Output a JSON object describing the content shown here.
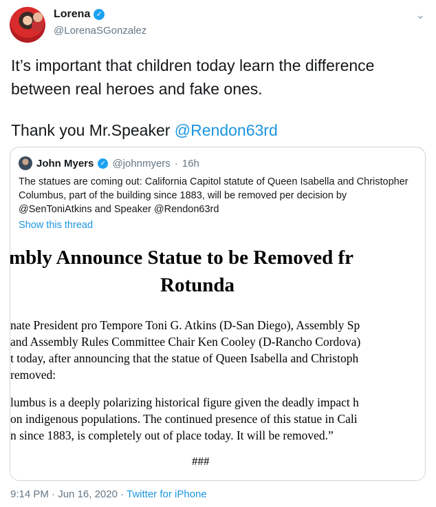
{
  "tweet": {
    "author_name": "Lorena",
    "author_handle": "@LorenaSGonzalez",
    "text_line1": "It’s important that children today learn the difference",
    "text_line2": "between real heroes and fake ones.",
    "text_line3_prefix": "Thank you Mr.Speaker ",
    "text_line3_mention": "@Rendon63rd",
    "timestamp": "9:14 PM · Jun 16, 2020 · ",
    "source": "Twitter for iPhone"
  },
  "quote": {
    "author_name": "John Myers",
    "author_handle": "@johnmyers",
    "separator": "·",
    "age": "16h",
    "text": "The statues are coming out: California Capitol statute of Queen Isabella and Christopher Columbus, part of the building since 1883, will be removed per decision by @SenToniAtkins and Speaker @Rendon63rd",
    "show_thread": "Show this thread",
    "document": {
      "title_line1": "mbly Announce Statue to be Removed fr",
      "title_line2": "Rotunda",
      "lines": [
        "nate President pro Tempore Toni G. Atkins (D-San Diego), Assembly Sp",
        "and Assembly Rules Committee Chair Ken Cooley (D-Rancho Cordova)",
        "t today, after announcing that the statue of Queen Isabella and Christoph",
        " removed:",
        "lumbus is a deeply polarizing historical figure given the deadly impact h",
        "on indigenous populations. The continued presence of this statue in Cali",
        "n since 1883, is completely out of place today. It will be removed.”"
      ],
      "end_mark": "###"
    }
  },
  "icons": {
    "verified": "verified-badge-icon",
    "menu": "chevron-down-icon"
  },
  "colors": {
    "link": "#1b95e0",
    "verified": "#1da1f2",
    "muted": "#657786",
    "border": "#ccd6dd"
  }
}
